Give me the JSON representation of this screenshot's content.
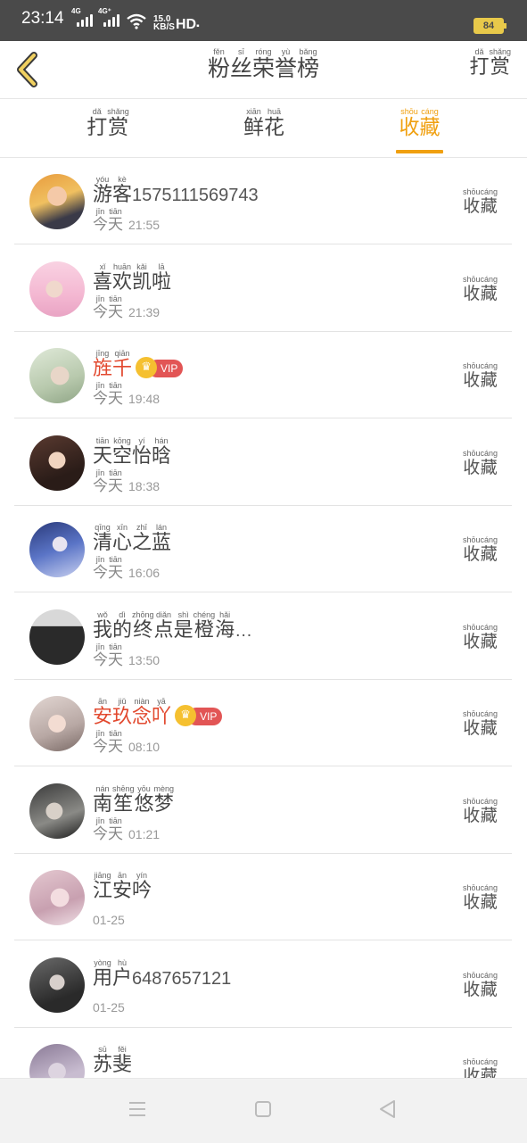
{
  "status_bar": {
    "time": "23:14",
    "sim1": "4G",
    "sim2": "4G⁺",
    "speed_value": "15.0",
    "speed_unit": "KB/S",
    "hd": "HD",
    "battery": "84"
  },
  "header": {
    "title_chars": [
      "粉",
      "丝",
      "荣",
      "誉",
      "榜"
    ],
    "title_pinyin": [
      "fěn",
      "sī",
      "róng",
      "yù",
      "bǎng"
    ],
    "reward_chars": [
      "打",
      "赏"
    ],
    "reward_pinyin": [
      "dǎ",
      "shǎng"
    ]
  },
  "tabs": [
    {
      "chars": [
        "打",
        "赏"
      ],
      "pinyin": [
        "dǎ",
        "shǎng"
      ],
      "active": false
    },
    {
      "chars": [
        "鲜",
        "花"
      ],
      "pinyin": [
        "xiān",
        "huā"
      ],
      "active": false
    },
    {
      "chars": [
        "收",
        "藏"
      ],
      "pinyin": [
        "shōu",
        "cáng"
      ],
      "active": true
    }
  ],
  "action_chars": [
    "收",
    "藏"
  ],
  "action_pinyin": [
    "shōu",
    "cáng"
  ],
  "today_chars": [
    "今",
    "天"
  ],
  "today_pinyin": [
    "jīn",
    "tiān"
  ],
  "entries": [
    {
      "name_chars": [
        "游",
        "客"
      ],
      "name_pinyin": [
        "yóu",
        "kè"
      ],
      "name_suffix": "1575111569743",
      "day": "今天",
      "time": "21:55",
      "vip": false
    },
    {
      "name_chars": [
        "喜",
        "欢",
        "凯",
        "啦"
      ],
      "name_pinyin": [
        "xǐ",
        "huān",
        "kǎi",
        "lā"
      ],
      "name_suffix": "",
      "day": "今天",
      "time": "21:39",
      "vip": false
    },
    {
      "name_chars": [
        "旌",
        "千"
      ],
      "name_pinyin": [
        "jīng",
        "qiān"
      ],
      "name_suffix": "",
      "day": "今天",
      "time": "19:48",
      "vip": true
    },
    {
      "name_chars": [
        "天",
        "空",
        "怡",
        "晗"
      ],
      "name_pinyin": [
        "tiān",
        "kōng",
        "yí",
        "hán"
      ],
      "name_suffix": "",
      "day": "今天",
      "time": "18:38",
      "vip": false
    },
    {
      "name_chars": [
        "清",
        "心",
        "之",
        "蓝"
      ],
      "name_pinyin": [
        "qīng",
        "xīn",
        "zhī",
        "lán"
      ],
      "name_suffix": "",
      "day": "今天",
      "time": "16:06",
      "vip": false
    },
    {
      "name_chars": [
        "我",
        "的",
        "终",
        "点",
        "是",
        "橙",
        "海"
      ],
      "name_pinyin": [
        "wǒ",
        "dì",
        "zhōng",
        "diǎn",
        "shì",
        "chéng",
        "hǎi"
      ],
      "name_suffix": "…",
      "day": "今天",
      "time": "13:50",
      "vip": false
    },
    {
      "name_chars": [
        "安",
        "玖",
        "念",
        "吖"
      ],
      "name_pinyin": [
        "ān",
        "jiǔ",
        "niàn",
        "yā"
      ],
      "name_suffix": "",
      "day": "今天",
      "time": "08:10",
      "vip": true
    },
    {
      "name_chars": [
        "南",
        "笙",
        "悠",
        "梦"
      ],
      "name_pinyin": [
        "nán",
        "shēng",
        "yōu",
        "mèng"
      ],
      "name_suffix": "",
      "day": "今天",
      "time": "01:21",
      "vip": false
    },
    {
      "name_chars": [
        "江",
        "安",
        "吟"
      ],
      "name_pinyin": [
        "jiāng",
        "ān",
        "yín"
      ],
      "name_suffix": "",
      "day": "",
      "time": "01-25",
      "vip": false
    },
    {
      "name_chars": [
        "用",
        "户"
      ],
      "name_pinyin": [
        "yòng",
        "hù"
      ],
      "name_suffix": "6487657121",
      "day": "",
      "time": "01-25",
      "vip": false
    },
    {
      "name_chars": [
        "苏",
        "斐"
      ],
      "name_pinyin": [
        "sū",
        "fěi"
      ],
      "name_suffix": "",
      "day": "",
      "time": "",
      "vip": false
    }
  ],
  "vip_label": "VIP",
  "colors": {
    "accent": "#f0a010",
    "vip_name": "#e2492f",
    "vip_badge": "#e25555",
    "crown": "#f5c030",
    "status_bar": "#4a4a4a"
  },
  "nav": {
    "menu_icon": "menu-icon",
    "home_icon": "home-icon",
    "back_icon": "back-triangle-icon"
  }
}
